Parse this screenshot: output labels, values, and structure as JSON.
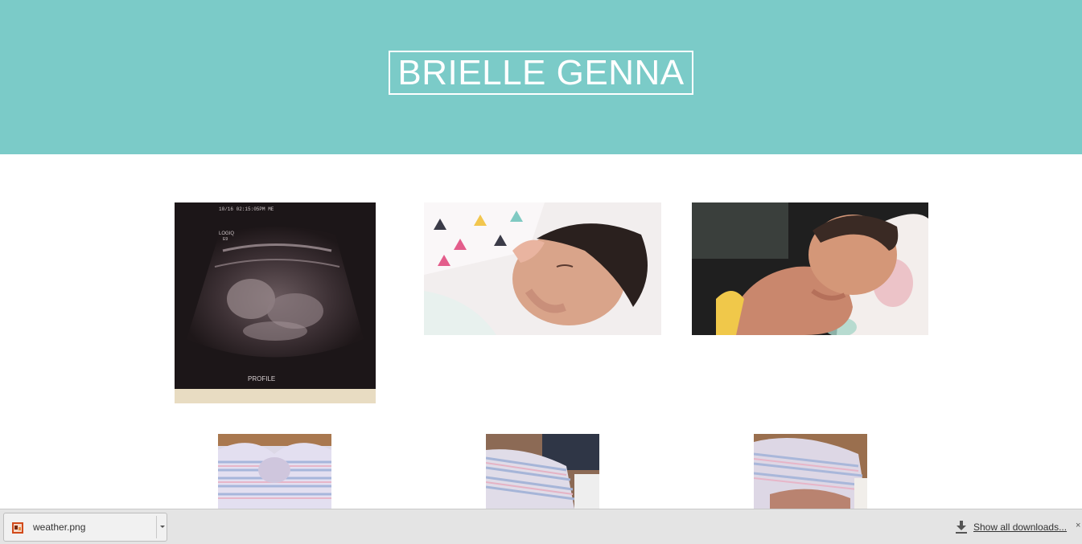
{
  "header": {
    "title": "BRIELLE GENNA",
    "background_color": "#7bcbc8"
  },
  "ultrasound": {
    "top_text": "10/16 02:15:05PM ME",
    "machine_label_1": "LOGIQ",
    "machine_label_2": "E9",
    "caption": "PROFILE"
  },
  "downloads_bar": {
    "file_name": "weather.png",
    "file_icon": "image-file-icon",
    "menu_icon": "chevron-down-icon",
    "show_all_label": "Show all downloads...",
    "download_icon": "download-icon",
    "close_icon": "close-icon",
    "close_glyph": "×"
  }
}
